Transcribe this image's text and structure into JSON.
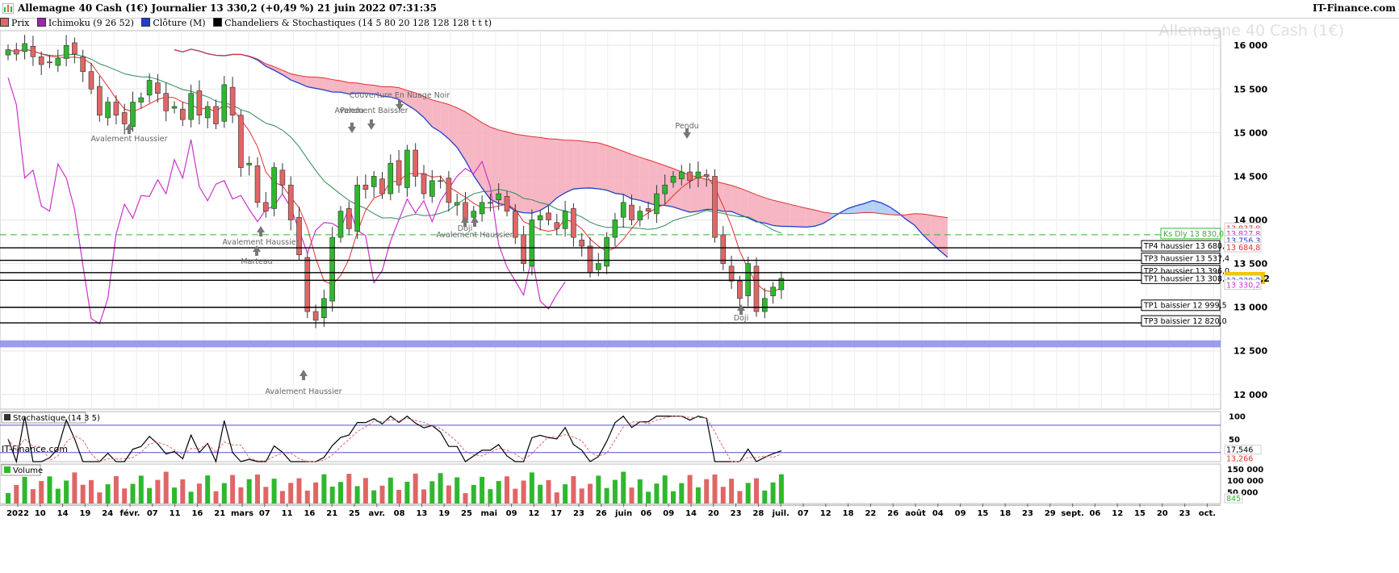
{
  "header": {
    "title": "Allemagne 40 Cash (1€) Journalier 13 330,2 (+0,49 %) 21 juin 2022 07:31:35",
    "brand": "IT-Finance.com"
  },
  "legend": [
    {
      "label": "Prix",
      "color": "#e06666"
    },
    {
      "label": "Ichimoku (9 26 52)",
      "color": "#9c27b0"
    },
    {
      "label": "Clôture (M)",
      "color": "#1f3fd0"
    },
    {
      "label": "Chandeliers & Stochastiques (14 5 80 20 128 128 128 t t t)",
      "color": "#000000"
    }
  ],
  "watermark": "Allemagne 40 Cash (1€)",
  "source_label": "IT-Finance.com",
  "colors": {
    "up": "#2eb82e",
    "down": "#e06666",
    "kijun": "#e03030",
    "tenkan": "#1f3fd0",
    "chikou": "#cc33cc",
    "lagging": "#2e8b57",
    "cloud_bull": "#a9c8f5",
    "cloud_bear": "#f5a9b8",
    "band": "#8a8aef"
  },
  "chart_data": [
    {
      "type": "candlestick",
      "title": "Allemagne 40 Cash (1€)",
      "ylim": [
        11850,
        16150
      ],
      "y_ticks": [
        "16 000",
        "15 500",
        "15 000",
        "14 500",
        "14 000",
        "13 500",
        "13 000",
        "12 500",
        "12 000"
      ],
      "x_ticks": [
        "2022",
        "10",
        "14",
        "19",
        "24",
        "févr.",
        "07",
        "11",
        "16",
        "21",
        "mars",
        "07",
        "11",
        "16",
        "21",
        "25",
        "avr.",
        "08",
        "13",
        "19",
        "25",
        "mai",
        "09",
        "12",
        "17",
        "23",
        "26",
        "juin",
        "06",
        "09",
        "14",
        "20",
        "23",
        "28",
        "juil.",
        "07",
        "12",
        "18",
        "22",
        "26",
        "août",
        "04",
        "09",
        "15",
        "18",
        "23",
        "29",
        "sept.",
        "06",
        "12",
        "15",
        "20",
        "23",
        "oct."
      ],
      "close_series": [
        15950,
        15900,
        16020,
        15870,
        15780,
        15800,
        15850,
        16000,
        15900,
        15700,
        15500,
        15200,
        15350,
        15200,
        15100,
        15350,
        15400,
        15600,
        15450,
        15250,
        15300,
        15150,
        15450,
        15200,
        15300,
        15100,
        15550,
        15200,
        14600,
        14650,
        14200,
        14100,
        14600,
        14400,
        14000,
        13600,
        12950,
        12850,
        13100,
        13800,
        14100,
        13900,
        14400,
        14350,
        14500,
        14300,
        14650,
        14400,
        14800,
        14500,
        14300,
        14450,
        14450,
        14200,
        14200,
        14000,
        14100,
        14200,
        14200,
        14300,
        14100,
        13800,
        13500,
        14000,
        14050,
        14000,
        13900,
        14100,
        13800,
        13700,
        13400,
        13500,
        13800,
        14000,
        14200,
        14000,
        14100,
        14100,
        14300,
        14400,
        14500,
        14550,
        14450,
        14550,
        14500,
        13800,
        13500,
        13300,
        13100,
        13500,
        12950,
        13100,
        13230,
        13330
      ],
      "stochastic": {
        "title": "Stochastique (14 3 5)",
        "ylim": [
          0,
          110
        ],
        "levels": [
          80,
          20
        ],
        "ticks": [
          "100",
          "50"
        ],
        "last_k": "17,546",
        "last_d": "13,266"
      },
      "volume": {
        "title": "Volume",
        "ticks": [
          "150 000",
          "100 000",
          "50 000"
        ],
        "last": "845"
      },
      "price_labels": [
        {
          "text": "Ks Dly 13 830,0",
          "value": 13830,
          "color": "#2eb82e"
        },
        {
          "text": "13 837,8",
          "value": 13900,
          "color": "#e03030"
        },
        {
          "text": "13 827,8",
          "value": 13840,
          "color": "#cc33cc"
        },
        {
          "text": "13 756,3",
          "value": 13760,
          "color": "#1f3fd0"
        },
        {
          "text": "13 684,8",
          "value": 13680,
          "color": "#e03030"
        },
        {
          "text": "13 330,2",
          "value": 13330,
          "color": "#000000",
          "highlight": true
        },
        {
          "text": "13 330,2",
          "value": 13300,
          "color": "#1f3fd0"
        },
        {
          "text": "13 330,2",
          "value": 13250,
          "color": "#cc33cc"
        }
      ],
      "levels": [
        {
          "label": "TP4 haussier 13 680,0",
          "value": 13680
        },
        {
          "label": "TP3 haussier 13 537,4",
          "value": 13537
        },
        {
          "label": "TP2 haussier 13 396,0",
          "value": 13396
        },
        {
          "label": "TP1 haussier 13 308,0",
          "value": 13308
        },
        {
          "label": "TP1 baissier 12 999,5",
          "value": 12999
        },
        {
          "label": "TP3 baissier 12 820,0",
          "value": 12820
        }
      ],
      "support_band": [
        12540,
        12620
      ],
      "annotations": [
        {
          "label": "Avalement Haussier",
          "dir": "up"
        },
        {
          "label": "Couverture En Nuage Noir",
          "dir": "down"
        },
        {
          "label": "Avalement Baissier",
          "dir": "down"
        },
        {
          "label": "Pendu",
          "dir": "down"
        },
        {
          "label": "Avalement Haussier",
          "dir": "up"
        },
        {
          "label": "Marteau",
          "dir": "up"
        },
        {
          "label": "Doji",
          "dir": "up"
        },
        {
          "label": "Avalement Haussier",
          "dir": "up"
        },
        {
          "label": "Avalement Haussier",
          "dir": "up"
        },
        {
          "label": "Doji",
          "dir": "up"
        },
        {
          "label": "Pendu",
          "dir": "down"
        }
      ]
    }
  ]
}
